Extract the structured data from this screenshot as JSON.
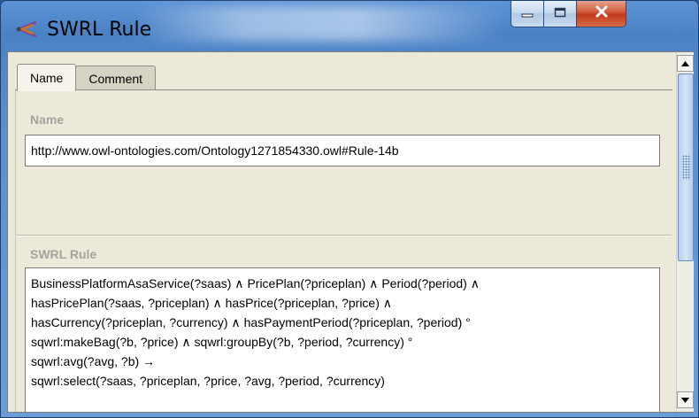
{
  "window": {
    "title": "SWRL Rule",
    "icon": "swrl-app-icon"
  },
  "caption_buttons": {
    "minimize_icon": "minimize-icon",
    "maximize_icon": "maximize-icon",
    "close_icon": "close-icon"
  },
  "tabs": [
    {
      "label": "Name",
      "active": true
    },
    {
      "label": "Comment",
      "active": false
    }
  ],
  "name_section": {
    "label": "Name",
    "value": "http://www.owl-ontologies.com/Ontology1271854330.owl#Rule-14b"
  },
  "rule_section": {
    "label": "SWRL Rule",
    "lines": [
      "BusinessPlatformAsaService(?saas) ∧ PricePlan(?priceplan) ∧ Period(?period) ∧",
      "hasPricePlan(?saas, ?priceplan) ∧ hasPrice(?priceplan, ?price) ∧",
      "hasCurrency(?priceplan, ?currency) ∧ hasPaymentPeriod(?priceplan, ?period) °",
      "sqwrl:makeBag(?b, ?price) ∧ sqwrl:groupBy(?b, ?period, ?currency) °",
      "sqwrl:avg(?avg, ?b) →",
      "sqwrl:select(?saas, ?priceplan, ?price, ?avg, ?period, ?currency)"
    ]
  },
  "scrollbar": {
    "up_icon": "scroll-up-arrow-icon",
    "down_icon": "scroll-down-arrow-icon"
  },
  "colors": {
    "title_bar": "#5a8fcf",
    "panel_background": "#ece9d8",
    "section_label": "#a6a39c",
    "close_button": "#c23a1d"
  }
}
